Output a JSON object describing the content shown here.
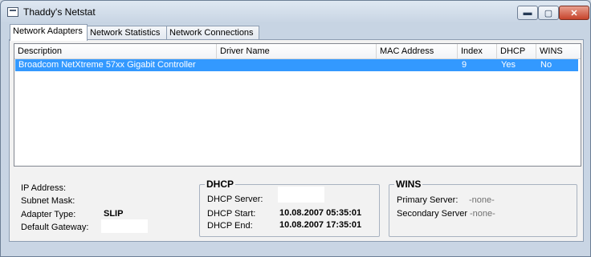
{
  "window": {
    "title": "Thaddy's Netstat"
  },
  "titlebar_buttons": {
    "minimize": "▬",
    "maximize": "▢",
    "close": "✕"
  },
  "tabs": [
    {
      "label": "Network Adapters"
    },
    {
      "label": "Network Statistics"
    },
    {
      "label": "Network Connections"
    }
  ],
  "table": {
    "columns": [
      "Description",
      "Driver Name",
      "MAC Address",
      "Index",
      "DHCP",
      "WINS"
    ],
    "rows": [
      {
        "description": "Broadcom NetXtreme 57xx Gigabit Controller",
        "driver_name": "",
        "mac_address": "",
        "index": "9",
        "dhcp": "Yes",
        "wins": "No"
      }
    ]
  },
  "info": {
    "ip_address_label": "IP Address:",
    "subnet_mask_label": "Subnet Mask:",
    "adapter_type_label": "Adapter Type:",
    "adapter_type_value": "SLIP",
    "default_gateway_label": "Default Gateway:"
  },
  "dhcp": {
    "title": "DHCP",
    "server_label": "DHCP Server:",
    "start_label": "DHCP Start:",
    "start_value": "10.08.2007 05:35:01",
    "end_label": "DHCP End:",
    "end_value": "10.08.2007 17:35:01"
  },
  "wins": {
    "title": "WINS",
    "primary_label": "Primary Server:",
    "primary_value": "-none-",
    "secondary_label": "Secondary Server",
    "secondary_value": "-none-"
  }
}
